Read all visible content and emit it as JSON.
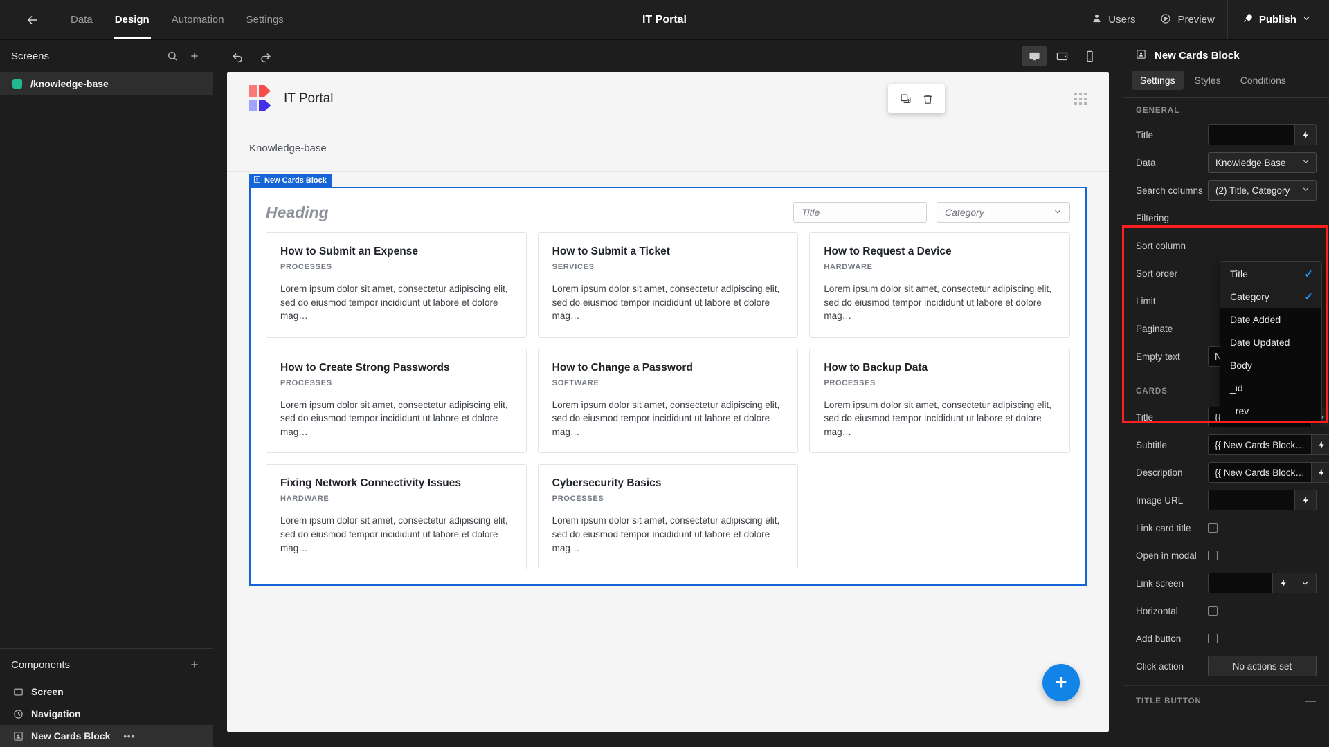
{
  "topbar": {
    "back_icon": "arrow-left-icon",
    "tabs": [
      {
        "label": "Data",
        "active": false
      },
      {
        "label": "Design",
        "active": true
      },
      {
        "label": "Automation",
        "active": false
      },
      {
        "label": "Settings",
        "active": false
      }
    ],
    "app_title": "IT Portal",
    "users_label": "Users",
    "preview_label": "Preview",
    "publish_label": "Publish"
  },
  "left_panel": {
    "screens_title": "Screens",
    "screens": [
      {
        "label": "/knowledge-base",
        "dot_color": "#21b892",
        "selected": true
      }
    ],
    "components_title": "Components",
    "components": [
      {
        "label": "Screen",
        "icon": "screen-icon",
        "selected": false
      },
      {
        "label": "Navigation",
        "icon": "navigation-icon",
        "selected": false
      },
      {
        "label": "New Cards Block",
        "icon": "cards-block-icon",
        "selected": true,
        "menu": "•••"
      }
    ]
  },
  "canvas_toolbar": {
    "undo_icon": "undo-icon",
    "redo_icon": "redo-icon",
    "devices": [
      {
        "name": "desktop-icon",
        "active": true
      },
      {
        "name": "tablet-icon",
        "active": false
      },
      {
        "name": "mobile-icon",
        "active": false
      }
    ]
  },
  "preview": {
    "brand": "IT Portal",
    "page_title": "Knowledge-base",
    "float_tools": [
      {
        "icon": "duplicate-icon"
      },
      {
        "icon": "trash-icon"
      }
    ],
    "block_tag": "New Cards Block",
    "heading": "Heading",
    "search_placeholder": "Title",
    "category_placeholder": "Category",
    "fab_label": "+",
    "card_body": "Lorem ipsum dolor sit amet, consectetur adipiscing elit, sed do eiusmod tempor incididunt ut labore et dolore mag…",
    "cards": [
      {
        "title": "How to Submit an Expense",
        "category": "PROCESSES"
      },
      {
        "title": "How to Submit a Ticket",
        "category": "SERVICES"
      },
      {
        "title": "How to Request a Device",
        "category": "HARDWARE"
      },
      {
        "title": "How to Create Strong Passwords",
        "category": "PROCESSES"
      },
      {
        "title": "How to Change a Password",
        "category": "SOFTWARE"
      },
      {
        "title": "How to Backup Data",
        "category": "PROCESSES"
      },
      {
        "title": "Fixing Network Connectivity Issues",
        "category": "HARDWARE"
      },
      {
        "title": "Cybersecurity Basics",
        "category": "PROCESSES"
      }
    ]
  },
  "right_panel": {
    "title": "New Cards Block",
    "icon": "cards-block-icon",
    "tabs": [
      {
        "label": "Settings",
        "active": true
      },
      {
        "label": "Styles",
        "active": false
      },
      {
        "label": "Conditions",
        "active": false
      }
    ],
    "general_section": "GENERAL",
    "general": {
      "title_label": "Title",
      "title_value": "",
      "data_label": "Data",
      "data_value": "Knowledge Base",
      "search_columns_label": "Search columns",
      "search_columns_value": "(2) Title, Category",
      "filtering_label": "Filtering",
      "sort_column_label": "Sort column",
      "sort_order_label": "Sort order",
      "limit_label": "Limit",
      "paginate_label": "Paginate",
      "empty_text_label": "Empty text",
      "empty_text_value": "No rows found"
    },
    "search_columns_dropdown": {
      "options": [
        {
          "label": "Title",
          "checked": true
        },
        {
          "label": "Category",
          "checked": true
        },
        {
          "label": "Date Added",
          "checked": false
        },
        {
          "label": "Date Updated",
          "checked": false
        },
        {
          "label": "Body",
          "checked": false
        },
        {
          "label": "_id",
          "checked": false
        },
        {
          "label": "_rev",
          "checked": false
        }
      ],
      "check_color": "#2196f3"
    },
    "cards_section": "CARDS",
    "cards": {
      "title_label": "Title",
      "title_value": "{{ New Cards Block…",
      "subtitle_label": "Subtitle",
      "subtitle_value": "{{ New Cards Block…",
      "description_label": "Description",
      "description_value": "{{ New Cards Block…",
      "image_url_label": "Image URL",
      "image_url_value": "",
      "link_card_title_label": "Link card title",
      "open_in_modal_label": "Open in modal",
      "link_screen_label": "Link screen",
      "link_screen_value": "",
      "horizontal_label": "Horizontal",
      "add_button_label": "Add button",
      "click_action_label": "Click action",
      "click_action_value": "No actions set"
    },
    "title_button_section": "TITLE BUTTON",
    "highlight_color": "#ff1f1f"
  }
}
